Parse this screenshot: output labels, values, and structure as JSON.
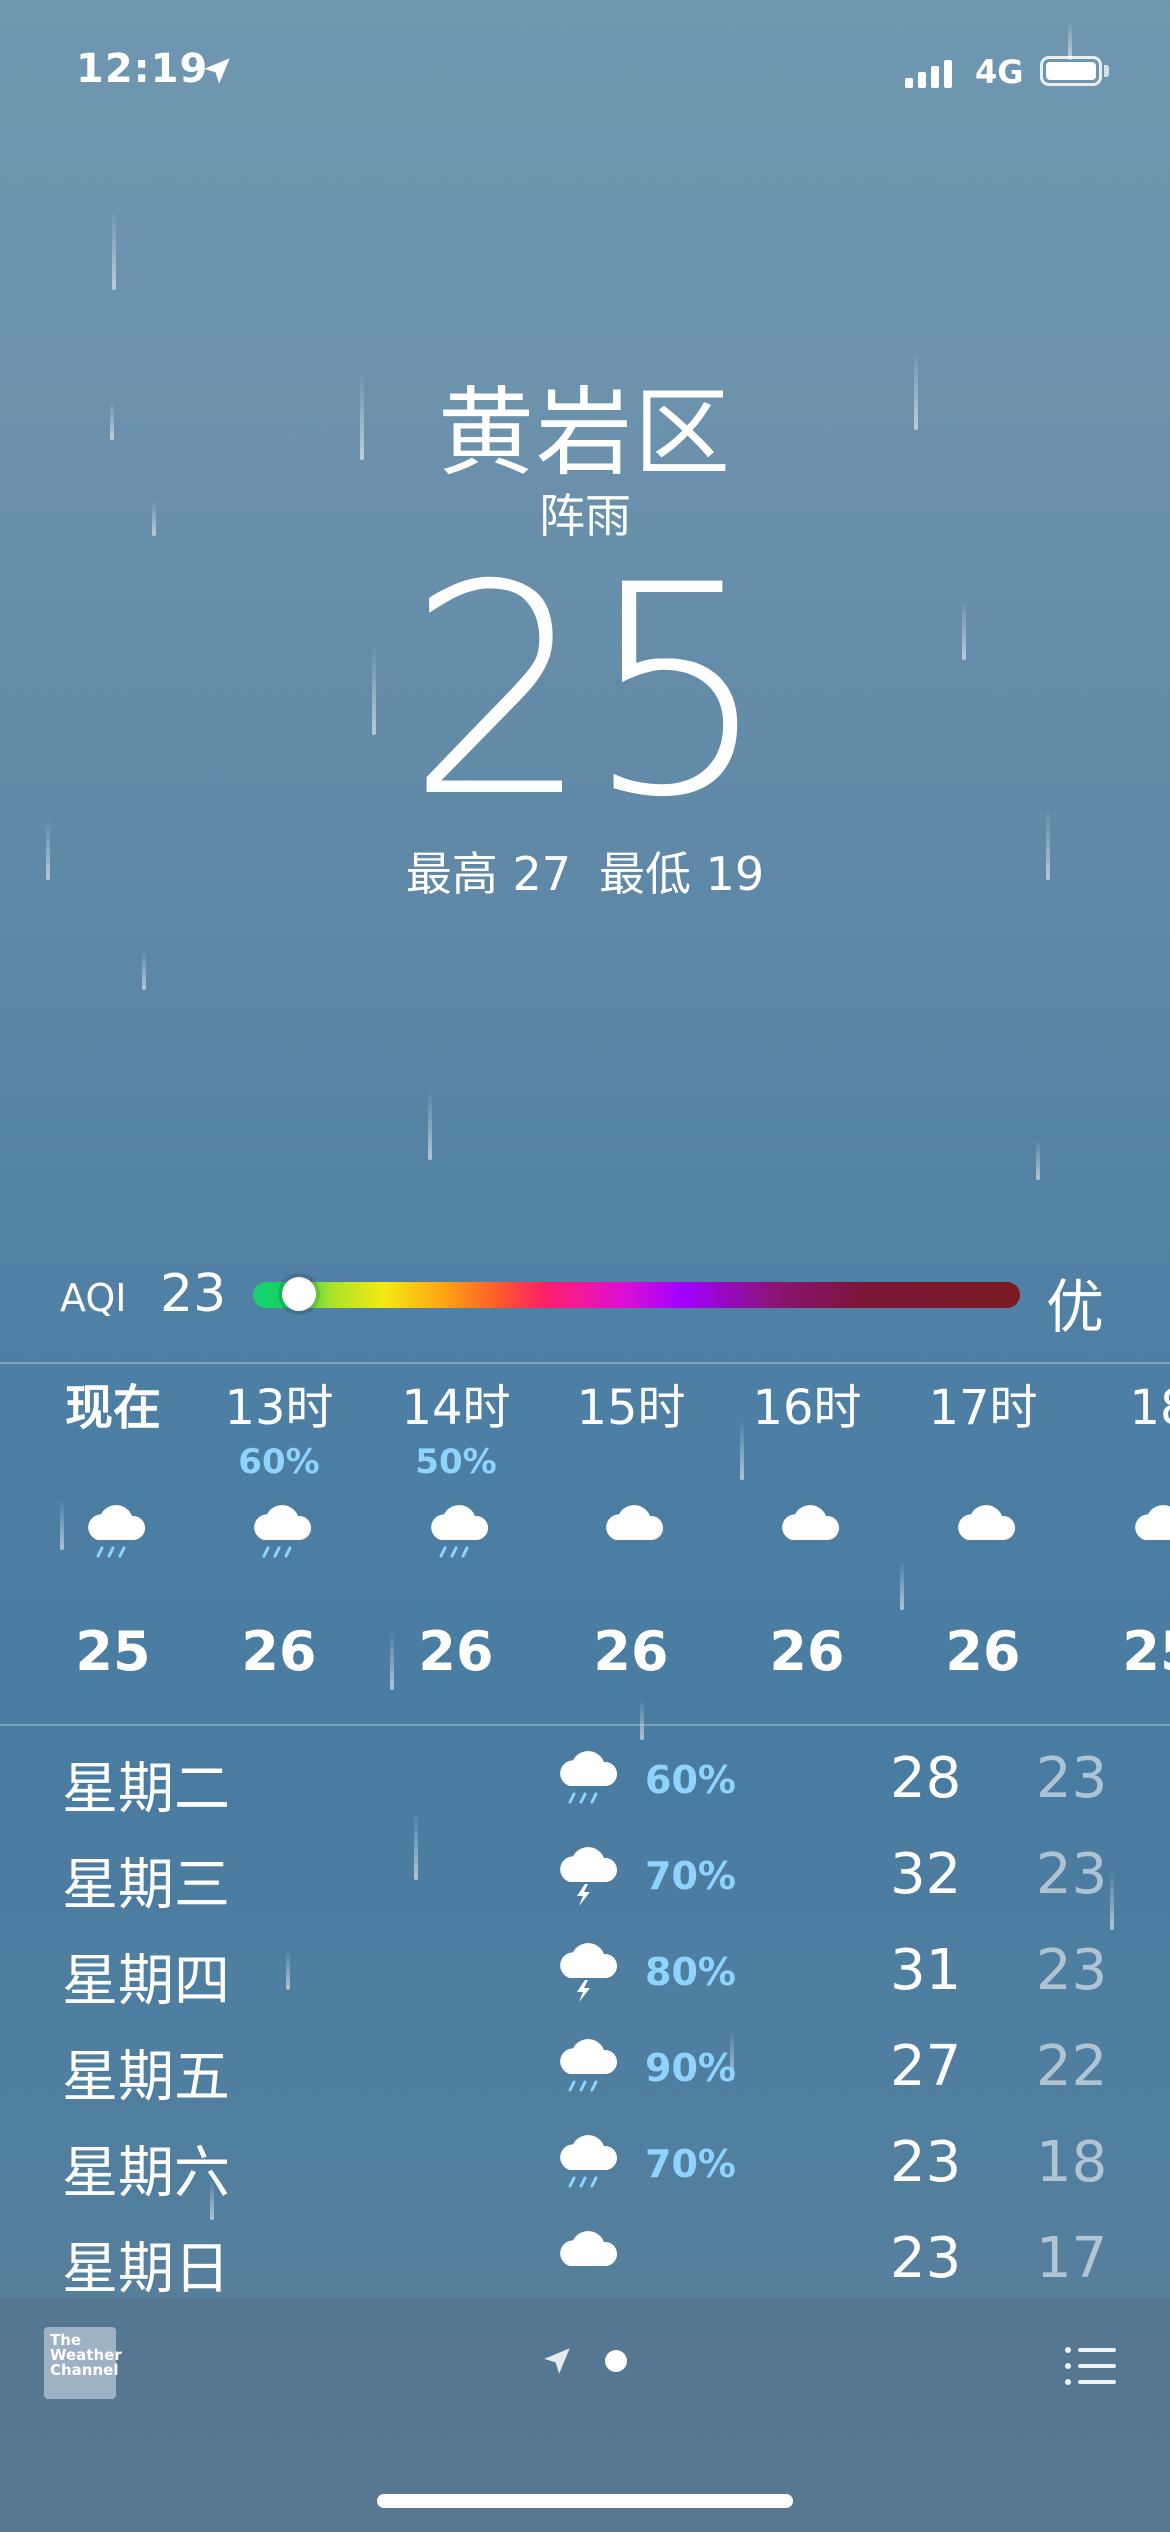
{
  "status_bar": {
    "time": "12:19",
    "network": "4G"
  },
  "header": {
    "city": "黄岩区",
    "condition": "阵雨",
    "temperature": "25",
    "high": "最高 27",
    "low": "最低 19"
  },
  "aqi": {
    "label": "AQI",
    "value": "23",
    "grade": "优",
    "level_fraction": 0.06
  },
  "hourly": [
    {
      "label": "现在",
      "pop": "",
      "icon": "rain-cloud-icon",
      "temp": "25"
    },
    {
      "label": "13时",
      "pop": "60%",
      "icon": "rain-cloud-icon",
      "temp": "26"
    },
    {
      "label": "14时",
      "pop": "50%",
      "icon": "rain-cloud-icon",
      "temp": "26"
    },
    {
      "label": "15时",
      "pop": "",
      "icon": "cloud-icon",
      "temp": "26"
    },
    {
      "label": "16时",
      "pop": "",
      "icon": "cloud-icon",
      "temp": "26"
    },
    {
      "label": "17时",
      "pop": "",
      "icon": "cloud-icon",
      "temp": "26"
    },
    {
      "label": "18",
      "pop": "",
      "icon": "cloud-icon",
      "temp": "25"
    }
  ],
  "daily": [
    {
      "day": "星期二",
      "icon": "rain-cloud-icon",
      "pop": "60%",
      "high": "28",
      "low": "23"
    },
    {
      "day": "星期三",
      "icon": "thunderstorm-icon",
      "pop": "70%",
      "high": "32",
      "low": "23"
    },
    {
      "day": "星期四",
      "icon": "thunderstorm-icon",
      "pop": "80%",
      "high": "31",
      "low": "23"
    },
    {
      "day": "星期五",
      "icon": "rain-cloud-icon",
      "pop": "90%",
      "high": "27",
      "low": "22"
    },
    {
      "day": "星期六",
      "icon": "rain-cloud-icon",
      "pop": "70%",
      "high": "23",
      "low": "18"
    },
    {
      "day": "星期日",
      "icon": "cloud-icon",
      "pop": "",
      "high": "23",
      "low": "17"
    }
  ],
  "footer": {
    "logo_lines": [
      "The",
      "Weather",
      "Channel"
    ]
  },
  "colors": {
    "precip": "#8fd3ff"
  }
}
